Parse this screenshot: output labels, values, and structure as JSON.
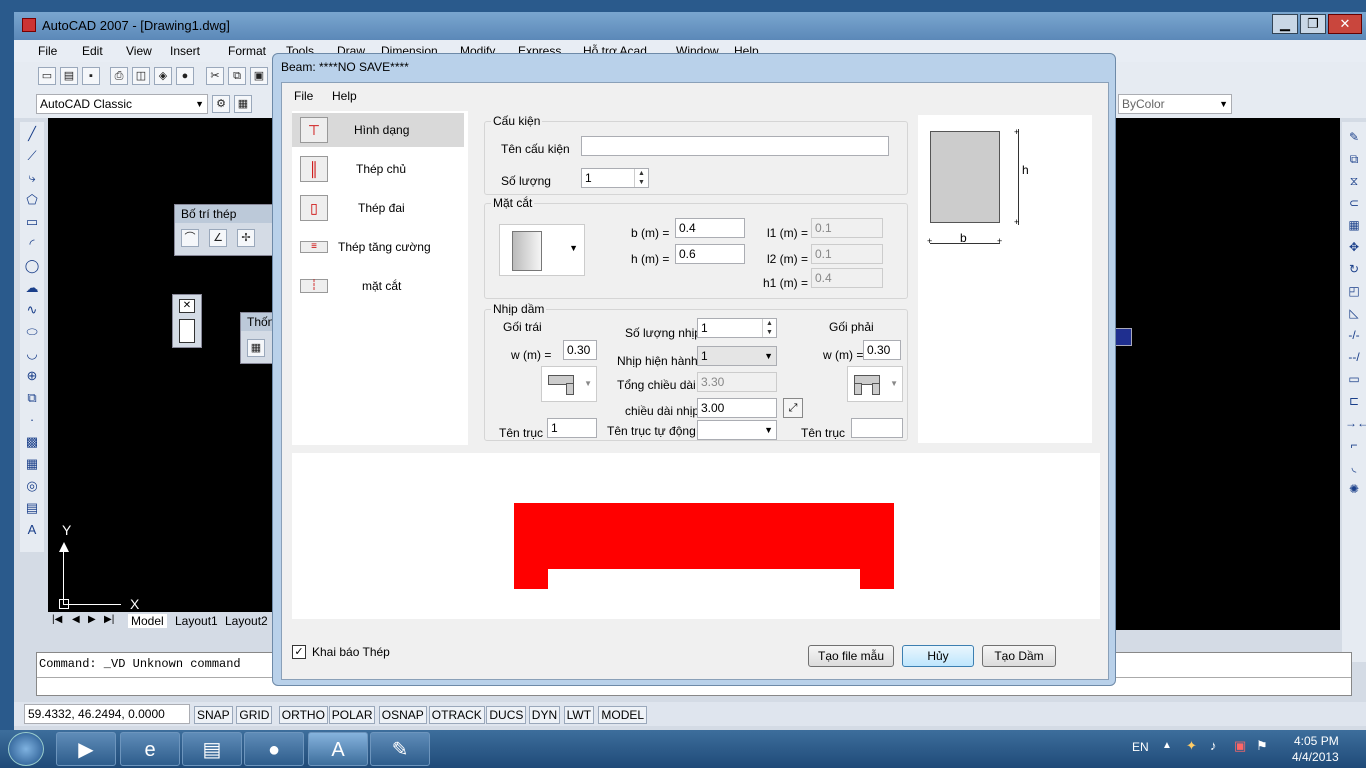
{
  "autocad": {
    "title": "AutoCAD 2007 - [Drawing1.dwg]",
    "menu": [
      "File",
      "Edit",
      "View",
      "Insert",
      "Format",
      "Tools",
      "Draw",
      "Dimension",
      "Modify",
      "Express",
      "Hỗ trợ Acad",
      "Window",
      "Help"
    ],
    "workspace": "AutoCAD Classic",
    "linetype": "ByColor",
    "floating_toolbar_1": "Bố trí thép",
    "floating_toolbar_2": "Thốn",
    "ucs_y": "Y",
    "ucs_x": "X",
    "tabs": [
      "Model",
      "Layout1",
      "Layout2"
    ],
    "command_text": "Command: _VD Unknown command",
    "coords": "59.4332, 46.2494, 0.0000",
    "status_buttons": [
      "SNAP",
      "GRID",
      "ORTHO",
      "POLAR",
      "OSNAP",
      "OTRACK",
      "DUCS",
      "DYN",
      "LWT",
      "MODEL"
    ],
    "left_tool_icons": [
      "line-icon",
      "xline-icon",
      "polyline-icon",
      "polygon-icon",
      "rectangle-icon",
      "arc-icon",
      "circle-icon",
      "cloud-icon",
      "spline-icon",
      "ellipse-icon",
      "ellipse-arc-icon",
      "insert-block-icon",
      "make-block-icon",
      "point-icon",
      "hatch-icon",
      "gradient-icon",
      "region-icon",
      "table-icon",
      "text-icon"
    ],
    "right_tool_icons": [
      "erase-icon",
      "copy-icon",
      "mirror-icon",
      "offset-icon",
      "array-icon",
      "move-icon",
      "rotate-icon",
      "scale-icon",
      "stretch-icon",
      "trim-icon",
      "extend-icon",
      "break-point-icon",
      "break-icon",
      "join-icon",
      "chamfer-icon",
      "fillet-icon",
      "explode-icon"
    ]
  },
  "dialog": {
    "title": "Beam: ****NO SAVE****",
    "menu": [
      "File",
      "Help"
    ],
    "nav": [
      {
        "label": "Hình dạng",
        "icon": "beam-shape-icon",
        "selected": true
      },
      {
        "label": "Thép chủ",
        "icon": "main-rebar-icon",
        "selected": false
      },
      {
        "label": "Thép đai",
        "icon": "stirrup-icon",
        "selected": false
      },
      {
        "label": "Thép tăng cường",
        "icon": "extra-rebar-icon",
        "selected": false
      },
      {
        "label": "mặt cắt",
        "icon": "section-icon",
        "selected": false
      }
    ],
    "cau_kien": {
      "legend": "Cấu kiện",
      "ten_label": "Tên cấu kiện",
      "ten_value": "",
      "so_luong_label": "Số lượng",
      "so_luong_value": "1"
    },
    "mat_cat": {
      "legend": "Mặt cắt",
      "b_label": "b (m) =",
      "b_value": "0.4",
      "h_label": "h (m) =",
      "h_value": "0.6",
      "l1_label": "l1 (m) =",
      "l1_value": "0.1",
      "l2_label": "l2 (m) =",
      "l2_value": "0.1",
      "h1_label": "h1 (m) =",
      "h1_value": "0.4"
    },
    "section_preview": {
      "h_label": "h",
      "b_label": "b"
    },
    "nhip_dam": {
      "legend": "Nhịp dầm",
      "goi_trai": "Gối trái",
      "goi_phai": "Gối phải",
      "w_left_label": "w (m) =",
      "w_left_value": "0.30",
      "w_right_label": "w (m) =",
      "w_right_value": "0.30",
      "so_luong_nhip_label": "Số lượng nhịp",
      "so_luong_nhip_value": "1",
      "nhip_hien_hanh_label": "Nhịp hiện hành",
      "nhip_hien_hanh_value": "1",
      "tong_chieu_dai_label": "Tổng chiều dài",
      "tong_chieu_dai_value": "3.30",
      "chieu_dai_nhip_label": "chiều dài nhịp",
      "chieu_dai_nhip_value": "3.00",
      "ten_truc_left_label": "Tên trục",
      "ten_truc_left_value": "1",
      "ten_truc_tu_dong_label": "Tên trục tự động",
      "ten_truc_tu_dong_value": "",
      "ten_truc_right_label": "Tên trục",
      "ten_truc_right_value": ""
    },
    "beam_color": "#ff0000",
    "khai_bao_thep_label": "Khai báo Thép",
    "khai_bao_thep_checked": true,
    "buttons": {
      "tao_file_mau": "Tạo file mẫu",
      "huy": "Hủy",
      "tao_dam": "Tạo Dầm"
    }
  },
  "taskbar": {
    "apps": [
      "start-orb-icon",
      "media-player-icon",
      "internet-explorer-icon",
      "file-explorer-icon",
      "firefox-icon",
      "autocad-icon",
      "paint-icon"
    ],
    "lang": "EN",
    "time": "4:05 PM",
    "date": "4/4/2013"
  }
}
